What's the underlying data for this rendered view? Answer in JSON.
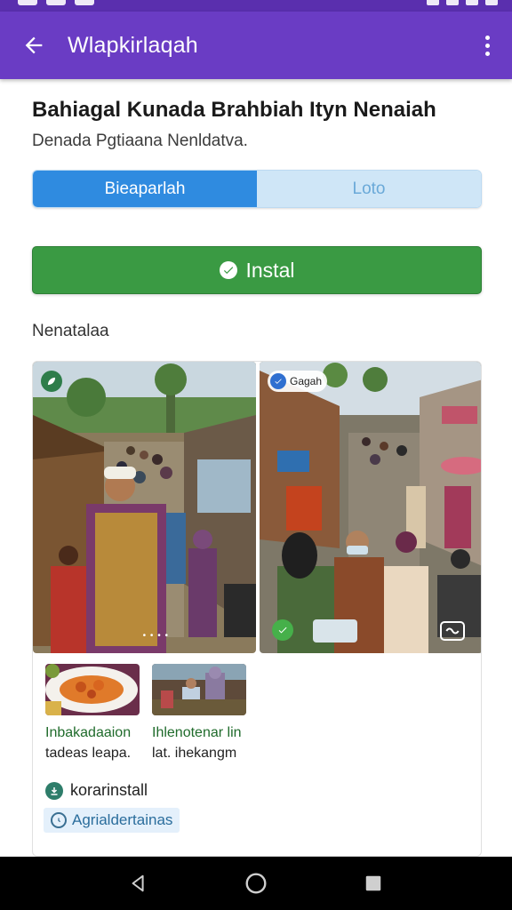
{
  "app_bar": {
    "title": "Wlapkirlaqah",
    "back_icon": "arrow-left-icon",
    "menu_icon": "more-vert-icon",
    "color": "#6a3cc4"
  },
  "app": {
    "name": "Bahiagal Kunada Brahbiah Ityn Nenaiah",
    "developer": "Denada Pgtiaana Nenldatva."
  },
  "tabs": [
    {
      "label": "Bieaparlah",
      "active": true
    },
    {
      "label": "Loto",
      "active": false
    }
  ],
  "install": {
    "label": "Instal",
    "icon": "check-circle-icon",
    "color": "#3a9a43"
  },
  "section": {
    "title": "Nenatalaa"
  },
  "screenshots": [
    {
      "caption": "• • • •",
      "badge_icon": "leaf-icon"
    },
    {
      "chip_label": "Gagah",
      "chip_icon": "check-icon",
      "play_icon": "play-icon",
      "video_icon": "video-icon"
    }
  ],
  "thumbnails": [
    {
      "line1": "Inbakadaaion",
      "line2": "tadeas leapa."
    },
    {
      "line1": "Ihlenotenar lin",
      "line2": "lat. ihekangm"
    }
  ],
  "meta": {
    "install_label": "korarinstall",
    "install_icon": "download-icon",
    "tag_label": "Agrialdertainas",
    "tag_icon": "clock-icon"
  },
  "nav": {
    "back_icon": "nav-back-icon",
    "home_icon": "nav-home-icon",
    "recents_icon": "nav-recents-icon"
  }
}
